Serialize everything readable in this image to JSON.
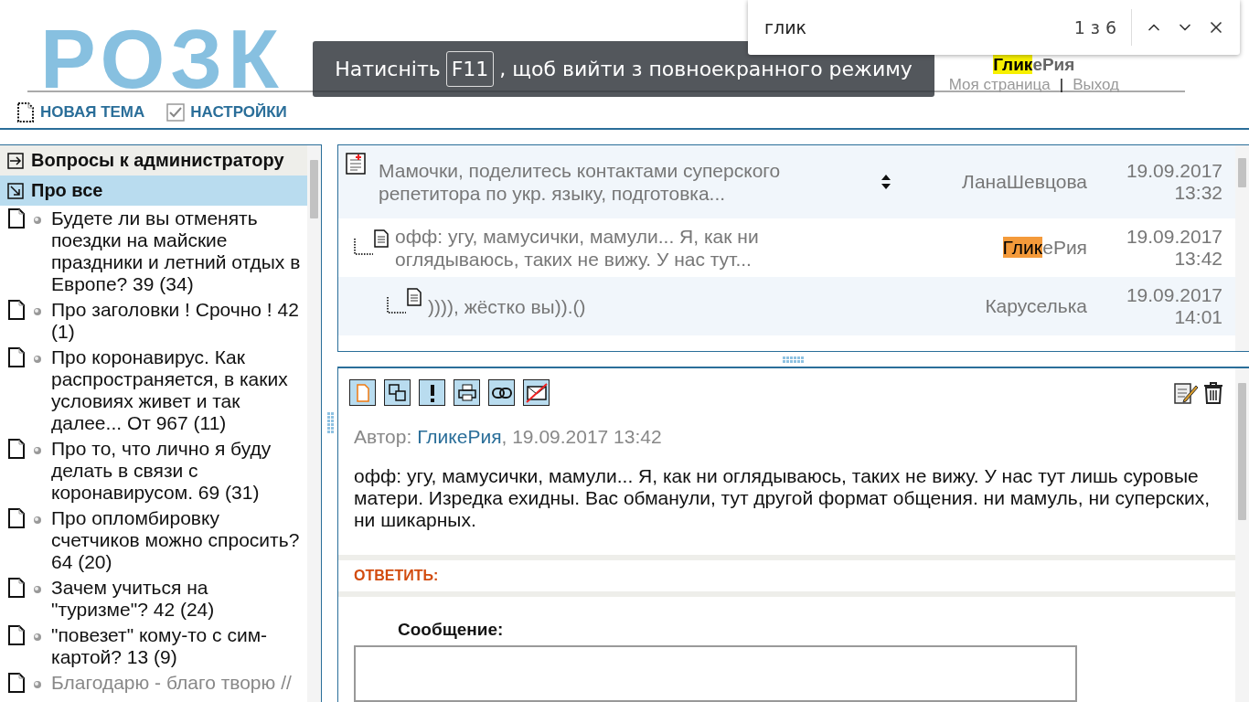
{
  "header": {
    "logo": "РОЗК",
    "user": [
      {
        "text": "Глик",
        "highlighted": true,
        "current": false
      },
      {
        "text": "еРия",
        "highlighted": false
      }
    ],
    "links": [
      "Моя страница",
      "Выход"
    ],
    "separator": "|"
  },
  "toolbar": [
    {
      "kind": "new",
      "label": "НОВАЯ ТЕМА"
    },
    {
      "kind": "settings",
      "label": "НАСТРОЙКИ"
    }
  ],
  "fullscreen_notice": {
    "before": "Натисніть",
    "key": "F11",
    "after": ", щоб вийти з повноекранного режиму"
  },
  "find_bar": {
    "value": "глик",
    "count": "1 з 6"
  },
  "sidebar": {
    "sections": [
      {
        "title": "Вопросы к администратору",
        "expanded": false,
        "selected": false
      },
      {
        "title": "Про все",
        "expanded": true,
        "selected": true
      }
    ],
    "items": [
      {
        "text": "Будете ли вы отменять поездки на майские праздники и летний отдых в Европе? 39 (34)",
        "muted": false
      },
      {
        "text": "Про заголовки ! Срочно ! 42 (1)",
        "muted": false
      },
      {
        "text": "Про коронавирус. Как распространяется, в каких условиях живет и так далее... От 967 (11)",
        "muted": false
      },
      {
        "text": "Про то, что лично я буду делать в связи с коронавирусом. 69 (31)",
        "muted": false
      },
      {
        "text": "Про опломбировку счетчиков можно спросить? 64 (20)",
        "muted": false
      },
      {
        "text": "Зачем учиться на \"туризме\"? 42 (24)",
        "muted": false
      },
      {
        "text": "\"повезет\" кому-то с сим-картой? 13 (9)",
        "muted": false
      },
      {
        "text": "Благодарю - благо творю //",
        "muted": true
      }
    ]
  },
  "threads": [
    {
      "kind": "topic",
      "title": "Мамочки, поделитесь контактами суперского репетитора по укр. языку, подготовка...",
      "author": [
        {
          "text": "ЛанаШевцова",
          "highlighted": false
        }
      ],
      "date": "19.09.2017",
      "time": "13:32",
      "children": [
        {
          "kind": "reply",
          "title": "офф: угу, мамусички, мамули... Я, как ни оглядываюсь, таких не вижу. У нас тут...",
          "author": [
            {
              "text": "Глик",
              "highlighted": true,
              "current": true
            },
            {
              "text": "еРия",
              "highlighted": false
            }
          ],
          "date": "19.09.2017",
          "time": "13:42",
          "children": [
            {
              "kind": "reply",
              "title": ")))), жёстко вы)).()",
              "author": [
                {
                  "text": "Каруселька",
                  "highlighted": false
                }
              ],
              "date": "19.09.2017",
              "time": "14:01"
            }
          ]
        }
      ]
    }
  ],
  "message": {
    "author_label": "Автор:",
    "author": "ГликеРия",
    "date": ", 19.09.2017 13:42",
    "body": "офф: угу, мамусички, мамули... Я, как ни оглядываюсь, таких не вижу. У нас тут лишь суровые матери. Изредка ехидны. Вас обманули, тут другой формат общения. ни мамуль, ни суперских, ни шикарных."
  },
  "reply": {
    "title": "ОТВЕТИТЬ:",
    "label": "Сообщение:"
  }
}
